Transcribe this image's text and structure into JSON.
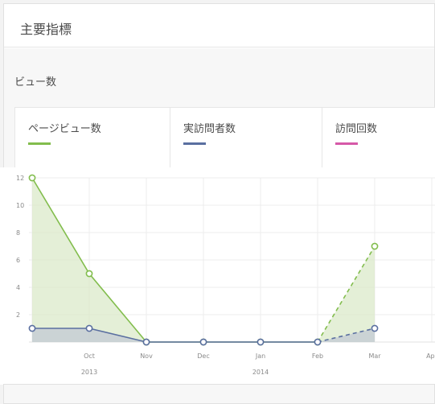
{
  "panel": {
    "title": "主要指標"
  },
  "section": {
    "title": "ビュー数"
  },
  "legend": [
    {
      "label": "ページビュー数",
      "color": "#82bd4d"
    },
    {
      "label": "実訪問者数",
      "color": "#5a6fa0"
    },
    {
      "label": "訪問回数",
      "color": "#d659a8"
    }
  ],
  "chart_data": {
    "type": "line",
    "x": [
      "2013-09",
      "2013-10",
      "2013-11",
      "2013-12",
      "2014-01",
      "2014-02",
      "2014-03"
    ],
    "x_tick_labels": [
      "Oct",
      "Nov",
      "Dec",
      "Jan",
      "Feb",
      "Mar",
      "Apr"
    ],
    "x_year_labels": [
      "2013",
      "2014"
    ],
    "ylim": [
      0,
      12
    ],
    "y_ticks": [
      2,
      4,
      6,
      8,
      10,
      12
    ],
    "grid": true,
    "series": [
      {
        "name": "ページビュー数",
        "values": [
          12,
          5,
          0,
          0,
          0,
          0,
          7
        ],
        "color": "#82bd4d",
        "fill": "#dbe9c9",
        "projected_last_segment": true
      },
      {
        "name": "実訪問者数",
        "values": [
          1,
          1,
          0,
          0,
          0,
          0,
          1
        ],
        "color": "#5a6fa0",
        "fill": "#c3c9d4",
        "projected_last_segment": true
      }
    ]
  }
}
